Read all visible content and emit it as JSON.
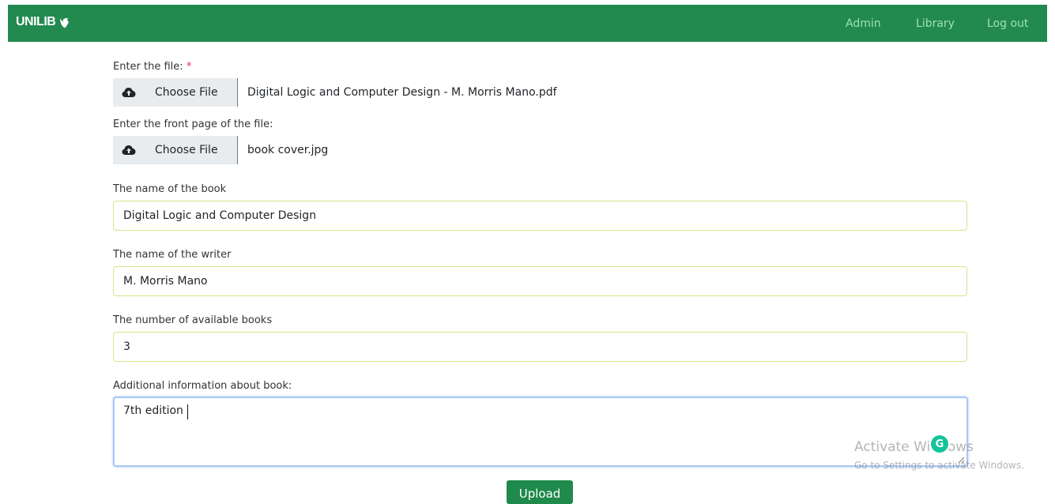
{
  "navbar": {
    "brand": "UNILIB",
    "brand_icon": "typo3-logo-icon",
    "links": [
      "Admin",
      "Library",
      "Log out"
    ],
    "background": "#228a4f",
    "link_color": "#9fe0b5"
  },
  "form": {
    "file": {
      "label": "Enter the file:",
      "required_mark": "*",
      "button_label": "Choose File",
      "button_icon": "cloud-upload-icon",
      "selected": "Digital Logic and Computer Design - M. Morris Mano.pdf"
    },
    "front_page": {
      "label": "Enter the front page of the file:",
      "button_label": "Choose File",
      "button_icon": "cloud-upload-icon",
      "selected": "book cover.jpg"
    },
    "book_name": {
      "label": "The name of the book",
      "value": "Digital Logic and Computer Design"
    },
    "writer_name": {
      "label": "The name of the writer",
      "value": "M. Morris Mano"
    },
    "available": {
      "label": "The number of available books",
      "value": "3"
    },
    "additional": {
      "label": "Additional information about book:",
      "value": "7th edition"
    },
    "submit_label": "Upload",
    "submit_color": "#1f8a4c"
  },
  "overlay": {
    "grammarly_icon": "grammarly-icon",
    "watermark_title": "Activate Windows",
    "watermark_sub": "Go to Settings to activate Windows."
  }
}
